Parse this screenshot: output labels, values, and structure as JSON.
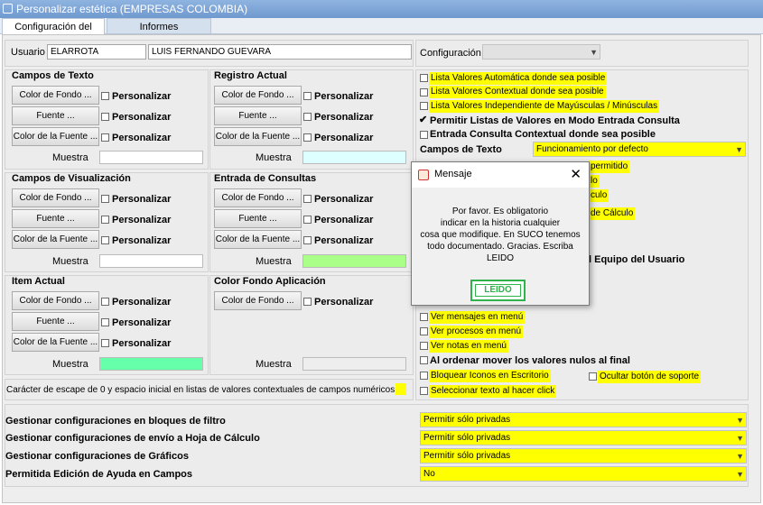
{
  "window": {
    "title": "Personalizar estética (EMPRESAS COLOMBIA)"
  },
  "tabs": [
    "Configuración del Usuario",
    "Informes"
  ],
  "user": {
    "label": "Usuario",
    "code": "ELARROTA",
    "name": "LUIS FERNANDO GUEVARA"
  },
  "config": {
    "label": "Configuración",
    "value": ""
  },
  "common": {
    "fondo": "Color de Fondo ...",
    "fuente": "Fuente ...",
    "colorFuente": "Color de la Fuente ...",
    "personalizar": "Personalizar",
    "muestra": "Muestra"
  },
  "groups": {
    "camposTexto": "Campos de Texto",
    "registroActual": "Registro Actual",
    "camposVisualizacion": "Campos de Visualización",
    "entradaConsultas": "Entrada de Consultas",
    "itemActual": "Item Actual",
    "colorFondoApp": "Color Fondo Aplicación"
  },
  "samples": {
    "camposTexto": "#ffffff",
    "registroActual": "#ddffff",
    "camposVisualizacion": "#ffffff",
    "entradaConsultas": "#aaff88",
    "itemActual": "#66ffaa",
    "colorFondoApp": "#eeeeee"
  },
  "escape": {
    "label": "Carácter de escape de 0 y espacio inicial en listas de valores contextuales de campos numéricos"
  },
  "right": {
    "opt1": "Lista Valores Automática donde sea posible",
    "opt2": "Lista Valores Contextual donde sea posible",
    "opt3": "Lista Valores Independiente de Mayúsculas / Minúsculas",
    "opt4": "Permitir Listas de Valores en Modo Entrada Consulta",
    "opt5": "Entrada Consulta Contextual donde sea posible",
    "camposTextoLabel": "Campos de Texto",
    "camposTextoValue": "Funcionamiento por defecto",
    "frag1": "permitido",
    "frag2": "lo",
    "frag3": "culo",
    "frag4": "de Cálculo",
    "frag5": "l Equipo del Usuario",
    "mensajes": "Ver mensajes en menú",
    "procesos": "Ver procesos en menú",
    "notas": "Ver notas en menú",
    "nulos": "Al ordenar mover los valores nulos al final",
    "bloquear": "Bloquear Iconos en Escritorio",
    "ocultar": "Ocultar botón de soporte",
    "seleccionar": "Seleccionar texto al hacer click"
  },
  "bottom": [
    {
      "label": "Gestionar configuraciones en bloques de filtro",
      "value": "Permitir sólo privadas"
    },
    {
      "label": "Gestionar configuraciones de envío a Hoja de Cálculo",
      "value": "Permitir sólo privadas"
    },
    {
      "label": "Gestionar configuraciones de Gráficos",
      "value": "Permitir sólo privadas"
    },
    {
      "label": "Permitida Edición de Ayuda en Campos",
      "value": "No"
    }
  ],
  "dialog": {
    "title": "Mensaje",
    "message": "Por favor. Es obligatorio\nindicar en la historia cualquier\ncosa que modifique. En SUCO tenemos\ntodo documentado. Gracias. Escriba\nLEIDO",
    "input": "LEIDO"
  },
  "colors": {
    "highlight": "#ffff00",
    "accent": "#2fb34a",
    "titlebar": "#7aa3d6"
  }
}
